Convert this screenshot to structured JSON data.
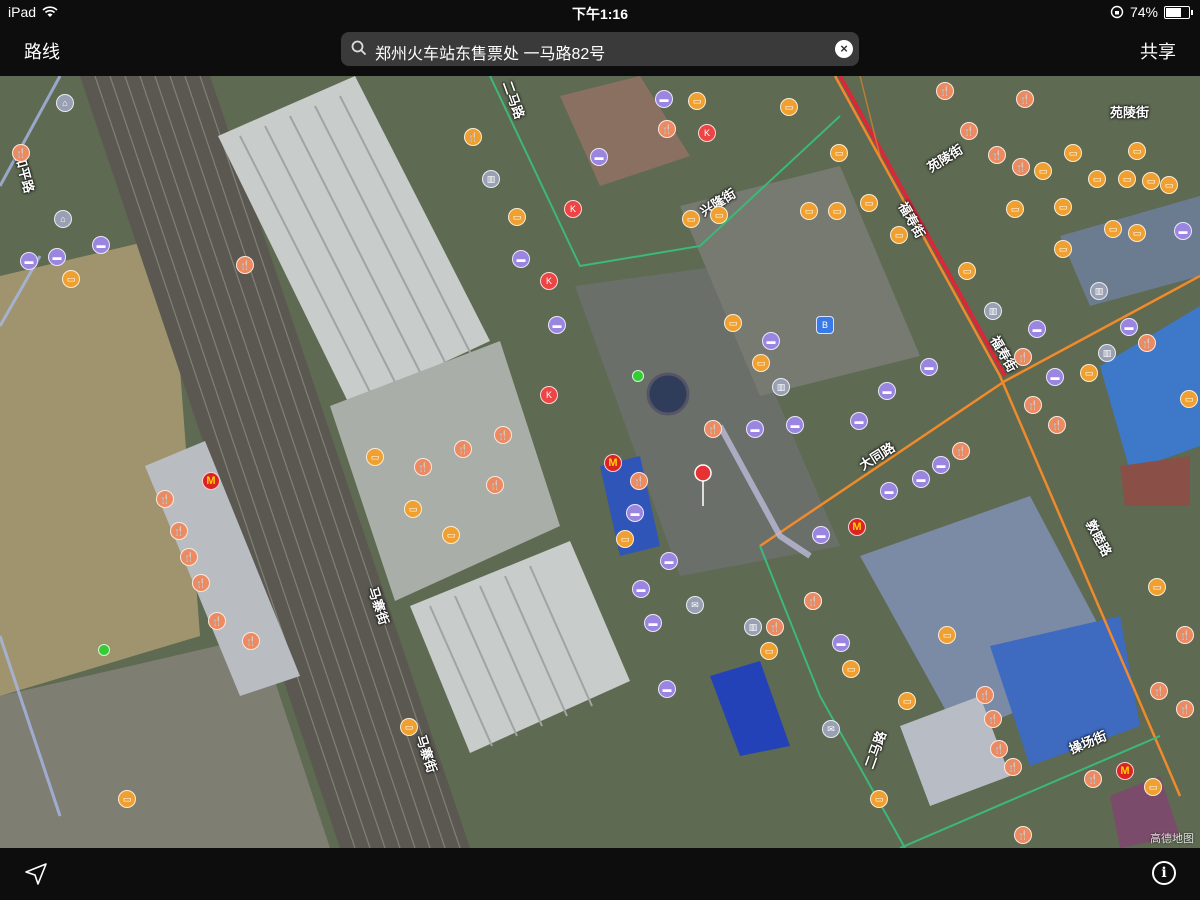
{
  "status_bar": {
    "device": "iPad",
    "time": "下午1:16",
    "battery_percent": "74%",
    "battery_level": 0.74
  },
  "nav_bar": {
    "left_label": "路线",
    "right_label": "共享",
    "search": {
      "value": "郑州火车站东售票处 一马路82号"
    }
  },
  "map": {
    "road_labels": [
      "二马路",
      "兴隆街",
      "苑陵街",
      "苑陵街",
      "福寿街",
      "福寿街",
      "和平路",
      "大同路",
      "敦睦路",
      "马寨街",
      "马寨街",
      "二马路",
      "操场街"
    ],
    "attribution": "高德地图",
    "icons": {
      "pin": "red-pin-icon",
      "mcdonalds": "mcdonalds-icon",
      "restaurant": "restaurant-icon",
      "hotel": "hotel-icon",
      "shopping": "shopping-icon",
      "bus": "bus-icon"
    },
    "colors": {
      "orange_poi": "#f0a030",
      "purple_poi": "#9a86e0",
      "red_road": "#d8283a",
      "orange_road": "#f08a2a",
      "green_road": "#3cb878"
    }
  },
  "bottom_bar": {
    "location_icon": "location-arrow-icon",
    "info_icon": "info-icon"
  }
}
